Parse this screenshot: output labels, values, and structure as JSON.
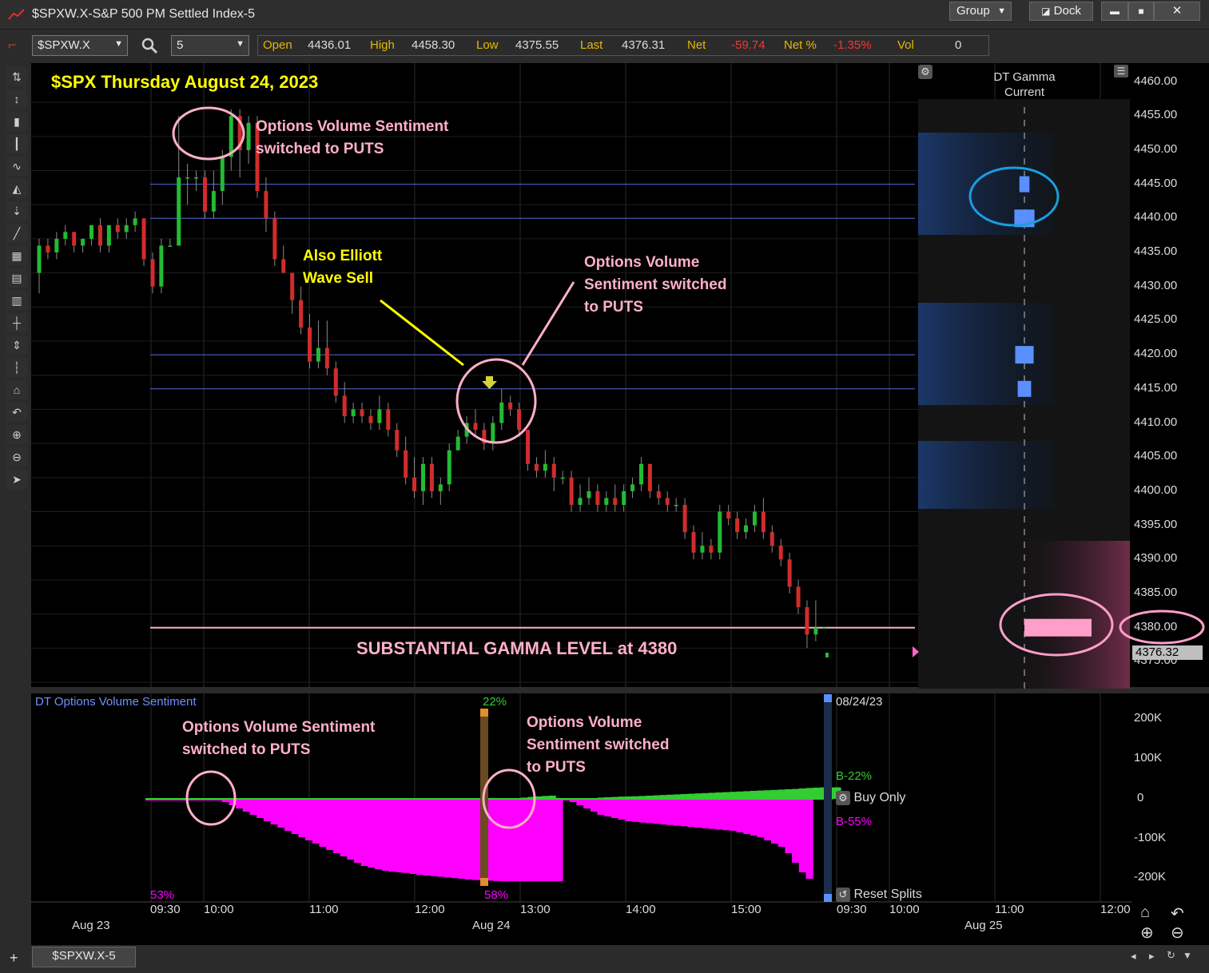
{
  "window": {
    "title": "$SPXW.X-S&P 500 PM Settled Index-5",
    "group_label": "Group",
    "dock_label": "Dock",
    "min_symbol": "▬",
    "max_symbol": "■",
    "close_symbol": "✕"
  },
  "toolbar": {
    "symbol": "$SPXW.X",
    "interval": "5",
    "open_label": "Open",
    "open_value": "4436.01",
    "high_label": "High",
    "high_value": "4458.30",
    "low_label": "Low",
    "low_value": "4375.55",
    "last_label": "Last",
    "last_value": "4376.31",
    "net_label": "Net",
    "net_value": "-59.74",
    "netpct_label": "Net %",
    "netpct_value": "-1.35%",
    "vol_label": "Vol",
    "vol_value": "0"
  },
  "tools": [
    "arrows-icon",
    "cursor-icon",
    "candles-icon",
    "bars-icon",
    "line-icon",
    "area-icon",
    "spacing-icon",
    "trend-icon",
    "grid-icon",
    "grid2-icon",
    "grid3-icon",
    "crosshair-icon",
    "drag-icon",
    "marker-icon",
    "home-icon",
    "undo-icon",
    "zoom-in-icon",
    "zoom-out-icon",
    "pointer-icon"
  ],
  "annotations": {
    "chart_title": "$SPX Thursday August 24, 2023",
    "puts_1_line1": "Options Volume Sentiment",
    "puts_1_line2": "switched to PUTS",
    "elliott_line1": "Also Elliott",
    "elliott_line2": "Wave Sell",
    "puts_2_line1": "Options Volume",
    "puts_2_line2": "Sentiment switched",
    "puts_2_line3": "to PUTS",
    "gamma_level": "SUBSTANTIAL GAMMA LEVEL at 4380",
    "lower_puts_1_line1": "Options Volume Sentiment",
    "lower_puts_1_line2": "switched to PUTS",
    "lower_puts_2_line1": "Options Volume",
    "lower_puts_2_line2": "Sentiment switched",
    "lower_puts_2_line3": "to PUTS"
  },
  "gamma_panel": {
    "title_line1": "DT Gamma",
    "title_line2": "Current"
  },
  "price_axis": {
    "ticks": [
      "4460.00",
      "4455.00",
      "4450.00",
      "4445.00",
      "4440.00",
      "4435.00",
      "4430.00",
      "4425.00",
      "4420.00",
      "4415.00",
      "4410.00",
      "4405.00",
      "4400.00",
      "4395.00",
      "4390.00",
      "4385.00",
      "4380.00",
      "4375.00"
    ],
    "last_price_label": "4376.32"
  },
  "lower_panel": {
    "indicator_name": "DT Options Volume Sentiment",
    "pct_top_marker": "22%",
    "pct_bottom_marker": "58%",
    "pct_left_bottom": "53%",
    "date_label": "08/24/23",
    "b_calls": "B-22%",
    "b_puts": "B-55%",
    "buy_only": "Buy Only",
    "reset_splits": "Reset Splits",
    "axis_ticks": [
      "200K",
      "100K",
      "0",
      "-100K",
      "-200K"
    ]
  },
  "time_axis": {
    "times": [
      "09:30",
      "10:00",
      "11:00",
      "12:00",
      "13:00",
      "14:00",
      "15:00",
      "09:30",
      "10:00",
      "11:00",
      "12:00"
    ],
    "dates": [
      "Aug 23",
      "Aug 24",
      "Aug 25"
    ]
  },
  "bottom_tab": {
    "tab_label": "$SPXW.X-5",
    "add_symbol": "+"
  },
  "colors": {
    "up": "#22bb33",
    "down": "#d12c2c",
    "calls_area": "#33cc33",
    "puts_area": "#ff00ff",
    "annotation_pink": "#ffb0c8",
    "annotation_yellow": "#ffff00",
    "gamma_blue": "#5a8fff",
    "gamma_pink": "#ff9ec8"
  },
  "chart_data": {
    "type": "candlestick",
    "title": "$SPX Thursday August 24, 2023",
    "ylim": [
      4372,
      4462
    ],
    "reference_lines": [
      4445,
      4440,
      4420,
      4415,
      4380
    ],
    "gamma_levels": [
      {
        "price": 4445,
        "strength": 0.3
      },
      {
        "price": 4440,
        "strength": 0.6
      },
      {
        "price": 4420,
        "strength": 0.55
      },
      {
        "price": 4415,
        "strength": 0.4
      },
      {
        "price": 4380,
        "strength": 2.0
      }
    ],
    "candles": [
      [
        4432,
        4436,
        4429,
        4437
      ],
      [
        4436,
        4435,
        4434,
        4437
      ],
      [
        4435,
        4437,
        4434,
        4438
      ],
      [
        4437,
        4438,
        4436,
        4439
      ],
      [
        4438,
        4436,
        4435,
        4438
      ],
      [
        4436,
        4437,
        4435,
        4437
      ],
      [
        4437,
        4439,
        4436,
        4439
      ],
      [
        4439,
        4436,
        4435,
        4440
      ],
      [
        4436,
        4439,
        4435,
        4439
      ],
      [
        4439,
        4438,
        4437,
        4440
      ],
      [
        4438,
        4439,
        4437,
        4440
      ],
      [
        4439,
        4440,
        4438,
        4441
      ],
      [
        4440,
        4434,
        4433,
        4440
      ],
      [
        4434,
        4430,
        4429,
        4435
      ],
      [
        4430,
        4436,
        4429,
        4437
      ],
      [
        4436,
        4436,
        4436,
        4437
      ],
      [
        4436,
        4446,
        4436,
        4455
      ],
      [
        4446,
        4446,
        4442,
        4448
      ],
      [
        4446,
        4446,
        4444,
        4447
      ],
      [
        4446,
        4441,
        4440,
        4447
      ],
      [
        4441,
        4444,
        4440,
        4447
      ],
      [
        4444,
        4449,
        4442,
        4450
      ],
      [
        4449,
        4455,
        4447,
        4456
      ],
      [
        4455,
        4450,
        4446,
        4456
      ],
      [
        4450,
        4454,
        4448,
        4455
      ],
      [
        4454,
        4444,
        4443,
        4455
      ],
      [
        4444,
        4440,
        4438,
        4446
      ],
      [
        4440,
        4434,
        4433,
        4441
      ],
      [
        4434,
        4432,
        4432,
        4436
      ],
      [
        4432,
        4428,
        4426,
        4432
      ],
      [
        4428,
        4424,
        4423,
        4430
      ],
      [
        4424,
        4419,
        4418,
        4426
      ],
      [
        4419,
        4421,
        4418,
        4425
      ],
      [
        4421,
        4418,
        4417,
        4425
      ],
      [
        4418,
        4414,
        4413,
        4419
      ],
      [
        4414,
        4411,
        4410,
        4416
      ],
      [
        4411,
        4412,
        4410,
        4413
      ],
      [
        4412,
        4411,
        4410,
        4413
      ],
      [
        4411,
        4410,
        4409,
        4412
      ],
      [
        4410,
        4412,
        4409,
        4414
      ],
      [
        4412,
        4409,
        4408,
        4413
      ],
      [
        4409,
        4406,
        4405,
        4410
      ],
      [
        4406,
        4402,
        4401,
        4408
      ],
      [
        4402,
        4400,
        4399,
        4405
      ],
      [
        4400,
        4404,
        4398,
        4405
      ],
      [
        4404,
        4400,
        4399,
        4405
      ],
      [
        4400,
        4401,
        4398,
        4402
      ],
      [
        4401,
        4406,
        4400,
        4407
      ],
      [
        4406,
        4408,
        4406,
        4409
      ],
      [
        4408,
        4410,
        4407,
        4411
      ],
      [
        4410,
        4409,
        4408,
        4412
      ],
      [
        4409,
        4407,
        4406,
        4410
      ],
      [
        4407,
        4410,
        4406,
        4411
      ],
      [
        4410,
        4413,
        4409,
        4415
      ],
      [
        4413,
        4412,
        4411,
        4414
      ],
      [
        4412,
        4409,
        4408,
        4413
      ],
      [
        4409,
        4404,
        4403,
        4409
      ],
      [
        4404,
        4403,
        4402,
        4405
      ],
      [
        4403,
        4404,
        4402,
        4406
      ],
      [
        4404,
        4402,
        4400,
        4405
      ],
      [
        4402,
        4402,
        4401,
        4403
      ],
      [
        4402,
        4398,
        4397,
        4403
      ],
      [
        4398,
        4399,
        4397,
        4401
      ],
      [
        4399,
        4400,
        4398,
        4402
      ],
      [
        4400,
        4398,
        4397,
        4401
      ],
      [
        4398,
        4399,
        4397,
        4400
      ],
      [
        4399,
        4398,
        4397,
        4401
      ],
      [
        4398,
        4400,
        4397,
        4401
      ],
      [
        4400,
        4401,
        4399,
        4402
      ],
      [
        4401,
        4404,
        4400,
        4405
      ],
      [
        4404,
        4400,
        4399,
        4404
      ],
      [
        4400,
        4399,
        4398,
        4401
      ],
      [
        4399,
        4398,
        4397,
        4400
      ],
      [
        4398,
        4398,
        4397,
        4399
      ],
      [
        4398,
        4394,
        4393,
        4399
      ],
      [
        4394,
        4391,
        4390,
        4395
      ],
      [
        4391,
        4392,
        4390,
        4394
      ],
      [
        4392,
        4391,
        4390,
        4393
      ],
      [
        4391,
        4397,
        4390,
        4398
      ],
      [
        4397,
        4396,
        4395,
        4398
      ],
      [
        4396,
        4394,
        4393,
        4397
      ],
      [
        4394,
        4395,
        4393,
        4396
      ],
      [
        4395,
        4397,
        4394,
        4398
      ],
      [
        4397,
        4394,
        4393,
        4399
      ],
      [
        4394,
        4392,
        4391,
        4395
      ],
      [
        4392,
        4390,
        4389,
        4393
      ],
      [
        4390,
        4386,
        4385,
        4391
      ],
      [
        4386,
        4383,
        4382,
        4387
      ],
      [
        4383,
        4379,
        4377,
        4384
      ],
      [
        4379,
        4380,
        4378,
        4384
      ],
      [
        4380,
        4380,
        4380,
        4380
      ]
    ],
    "sentiment_calls": [
      0,
      0,
      0,
      0,
      0,
      0,
      0,
      0,
      0,
      0,
      0,
      0,
      0,
      0,
      0,
      0,
      0,
      0,
      0,
      0,
      0,
      0,
      0,
      0,
      0,
      0,
      0,
      0,
      0,
      0,
      0,
      0,
      0,
      0,
      0,
      0,
      0,
      0,
      0,
      0,
      0,
      0,
      0,
      0,
      0,
      0,
      0,
      0,
      0,
      0,
      0,
      0,
      0,
      3,
      8,
      12,
      15,
      18,
      20,
      0,
      0,
      0,
      0,
      0,
      0,
      8,
      10,
      12,
      14,
      15,
      16,
      18,
      20,
      22,
      24,
      26,
      28,
      30,
      32,
      34,
      36,
      38,
      40,
      42,
      44,
      46,
      48,
      50,
      52,
      54,
      56,
      58,
      60,
      62,
      65,
      68,
      70,
      72,
      72,
      72
    ],
    "sentiment_puts": [
      -5,
      -5,
      -5,
      -5,
      -5,
      -5,
      -5,
      -5,
      -5,
      -5,
      -5,
      -10,
      -20,
      -30,
      -40,
      -50,
      -60,
      -70,
      -80,
      -90,
      -100,
      -110,
      -120,
      -130,
      -140,
      -150,
      -160,
      -170,
      -180,
      -190,
      -200,
      -210,
      -215,
      -220,
      -225,
      -228,
      -230,
      -232,
      -235,
      -238,
      -240,
      -242,
      -244,
      -246,
      -248,
      -250,
      -252,
      -254,
      -255,
      -256,
      -257,
      -258,
      -258,
      -258,
      -258,
      -258,
      -258,
      -258,
      -258,
      -258,
      -5,
      -10,
      -20,
      -30,
      -40,
      -50,
      -55,
      -60,
      -65,
      -70,
      -72,
      -74,
      -76,
      -78,
      -80,
      -82,
      -84,
      -86,
      -88,
      -90,
      -92,
      -94,
      -96,
      -98,
      -100,
      -105,
      -110,
      -115,
      -120,
      -130,
      -140,
      -150,
      -170,
      -200,
      -230,
      -250
    ]
  }
}
